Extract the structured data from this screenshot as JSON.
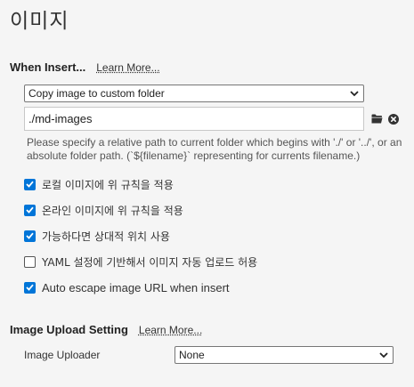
{
  "page": {
    "title": "이미지"
  },
  "when_insert": {
    "title": "When Insert...",
    "learn_more": "Learn More...",
    "action_select": {
      "selected": "Copy image to custom folder"
    },
    "path_input": {
      "value": "./md-images"
    },
    "hint": "Please specify a relative path to current folder which begins with './' or '../', or an absolute folder path. (`${filename}` representing for currents filename.)"
  },
  "options": [
    {
      "label": "로컬 이미지에 위 규칙을 적용",
      "checked": true
    },
    {
      "label": "온라인 이미지에 위 규칙을 적용",
      "checked": true
    },
    {
      "label": "가능하다면 상대적 위치 사용",
      "checked": true
    },
    {
      "label": "YAML 설정에 기반해서 이미지 자동 업로드 허용",
      "checked": false
    },
    {
      "label": "Auto escape image URL when insert",
      "checked": true
    }
  ],
  "upload": {
    "title": "Image Upload Setting",
    "learn_more": "Learn More...",
    "uploader_label": "Image Uploader",
    "uploader_select": {
      "selected": "None"
    }
  },
  "icons": {
    "folder": "folder-icon",
    "remove": "close-circle-icon",
    "chevron": "chevron-down-icon",
    "check": "checkmark-icon"
  },
  "colors": {
    "checkbox_accent": "#0075d8",
    "background": "#f5f5f5"
  }
}
